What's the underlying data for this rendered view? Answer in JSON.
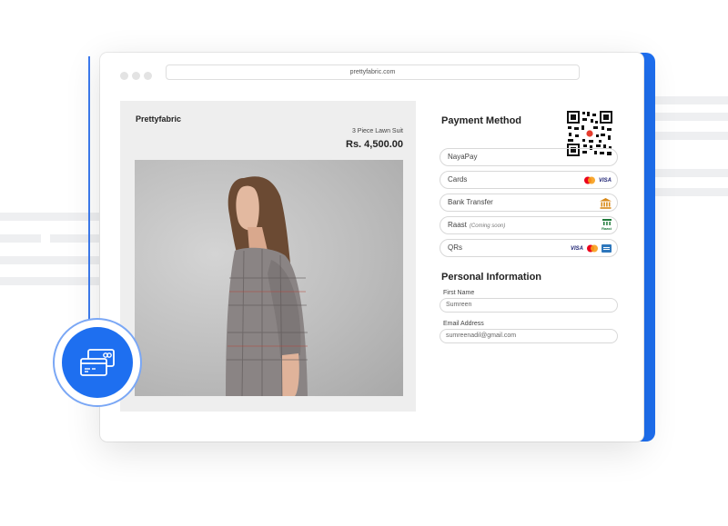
{
  "browser": {
    "url": "prettyfabric.com"
  },
  "product": {
    "brand": "Prettyfabric",
    "name": "3 Piece Lawn Suit",
    "price": "Rs. 4,500.00"
  },
  "payment": {
    "title": "Payment Method",
    "options": [
      {
        "label": "NayaPay",
        "sub": ""
      },
      {
        "label": "Cards",
        "sub": ""
      },
      {
        "label": "Bank Transfer",
        "sub": ""
      },
      {
        "label": "Raast",
        "sub": "(Coming soon)",
        "icon_text": "Raast"
      },
      {
        "label": "QRs",
        "sub": ""
      }
    ],
    "visa": "VISA"
  },
  "personal": {
    "title": "Personal Information",
    "first_name_label": "First Name",
    "first_name_value": "Sumreen",
    "email_label": "Email Address",
    "email_value": "sumreenadil@gmail.com"
  },
  "colors": {
    "accent": "#1e6ff0",
    "mastercard_red": "#eb001b",
    "mastercard_orange": "#f79e1b",
    "visa_blue": "#1a1f71",
    "bank_orange": "#d98a1a",
    "raast_green": "#1f7a3a"
  }
}
